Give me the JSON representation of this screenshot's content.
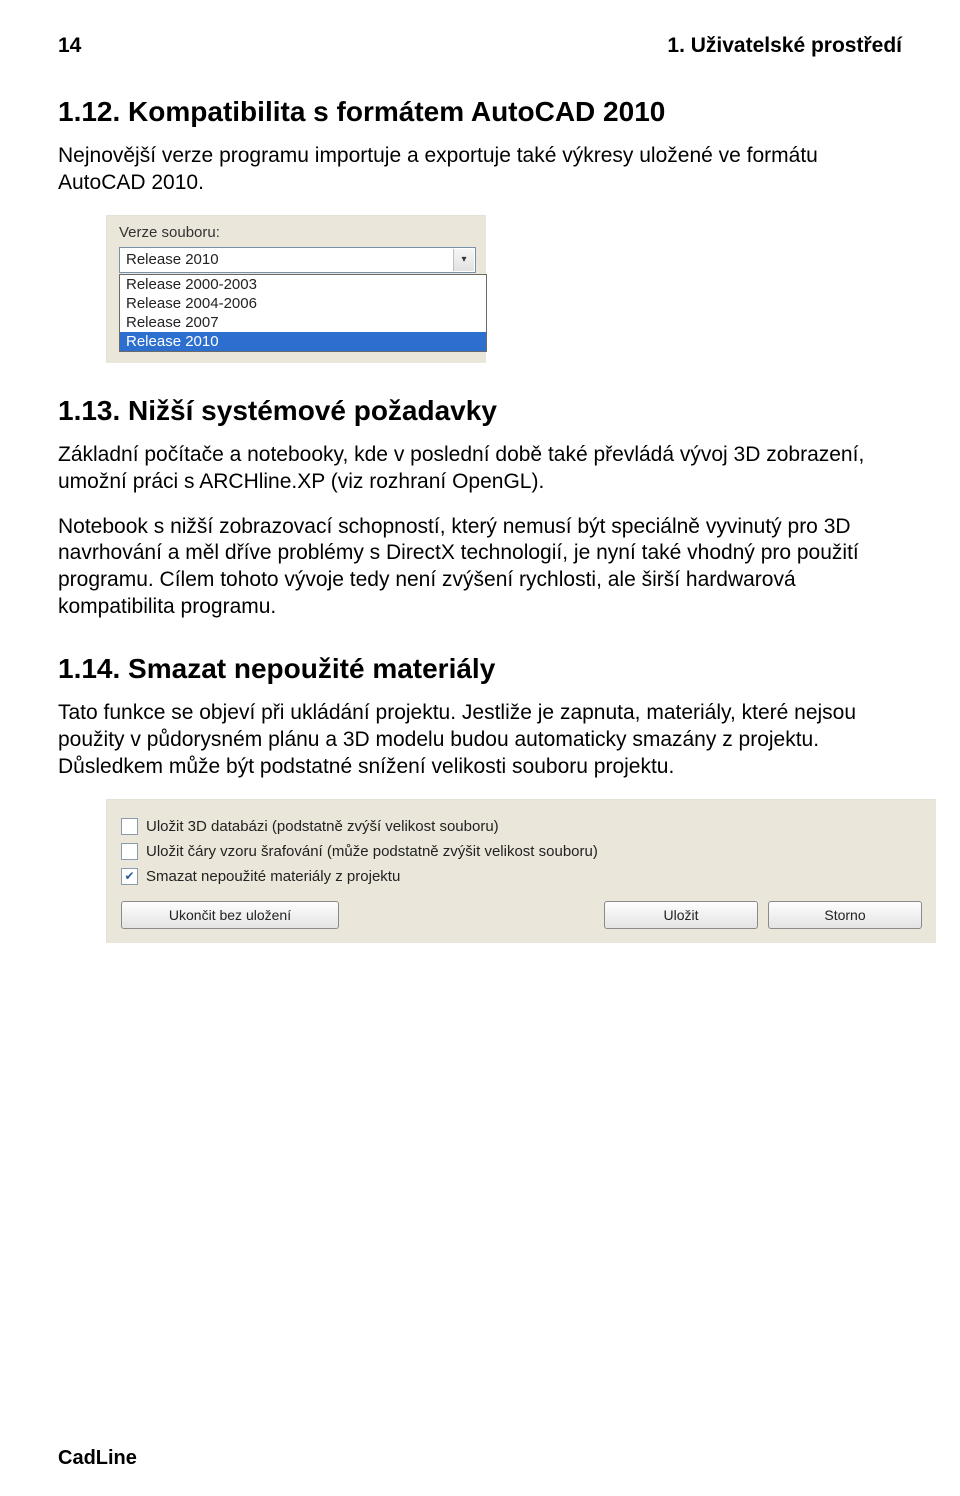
{
  "header": {
    "page": "14",
    "chapter": "1. Uživatelské prostředí"
  },
  "s112": {
    "title": "1.12.   Kompatibilita s formátem AutoCAD 2010",
    "p": "Nejnovější verze programu importuje a exportuje také výkresy uložené ve formátu AutoCAD 2010."
  },
  "verze": {
    "label": "Verze souboru:",
    "selected": "Release 2010",
    "options": [
      "Release 2000-2003",
      "Release 2004-2006",
      "Release 2007",
      "Release 2010"
    ],
    "highlighted": "Release 2010"
  },
  "s113": {
    "title": "1.13.   Nižší systémové požadavky",
    "p1": "Základní počítače a notebooky, kde v poslední době také převládá vývoj 3D zobrazení, umožní práci s ARCHline.XP (viz rozhraní OpenGL).",
    "p2": "Notebook s nižší zobrazovací schopností, který nemusí být speciálně vyvinutý pro 3D navrhování a měl dříve problémy s DirectX technologií, je nyní také vhodný pro použití programu. Cílem tohoto vývoje tedy není zvýšení rychlosti, ale širší hardwarová kompatibilita programu."
  },
  "s114": {
    "title": "1.14.   Smazat nepoužité materiály",
    "p": "Tato funkce se objeví při ukládání projektu. Jestliže je zapnuta, materiály, které nejsou použity v půdorysném plánu a 3D modelu budou automaticky smazány z projektu. Důsledkem může být podstatné snížení velikosti souboru projektu."
  },
  "savebox": {
    "chk1": {
      "checked": false,
      "label": "Uložit 3D databázi (podstatně zvýší velikost souboru)"
    },
    "chk2": {
      "checked": false,
      "label": "Uložit čáry vzoru šrafování (může podstatně zvýšit velikost souboru)"
    },
    "chk3": {
      "checked": true,
      "label": "Smazat nepoužité materiály z projektu"
    },
    "btn_cancel_left": "Ukončit bez uložení",
    "btn_save": "Uložit",
    "btn_storno": "Storno"
  },
  "footer": "CadLine"
}
